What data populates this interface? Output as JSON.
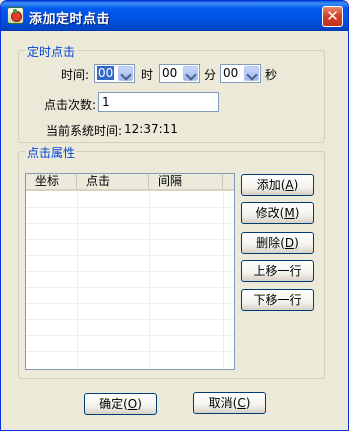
{
  "window": {
    "title": "添加定时点击",
    "close_glyph": "✕"
  },
  "timer_group": {
    "title": "定时点击",
    "time_label": "时间:",
    "hour_value": "00",
    "hour_unit": "时",
    "minute_value": "00",
    "minute_unit": "分",
    "second_value": "00",
    "second_unit": "秒",
    "click_count_label": "点击次数:",
    "click_count_value": "1",
    "system_time_label": "当前系统时间:",
    "system_time_value": "12:37:11"
  },
  "attr_group": {
    "title": "点击属性",
    "columns": [
      "坐标",
      "点击",
      "间隔"
    ],
    "rows": []
  },
  "side_buttons": {
    "add": {
      "text": "添加",
      "mnemonic": "A"
    },
    "edit": {
      "text": "修改",
      "mnemonic": "M"
    },
    "delete": {
      "text": "删除",
      "mnemonic": "D"
    },
    "move_up": "上移一行",
    "move_down": "下移一行"
  },
  "footer": {
    "ok": {
      "text": "确定",
      "mnemonic": "O"
    },
    "cancel": {
      "text": "取消",
      "mnemonic": "C"
    }
  }
}
